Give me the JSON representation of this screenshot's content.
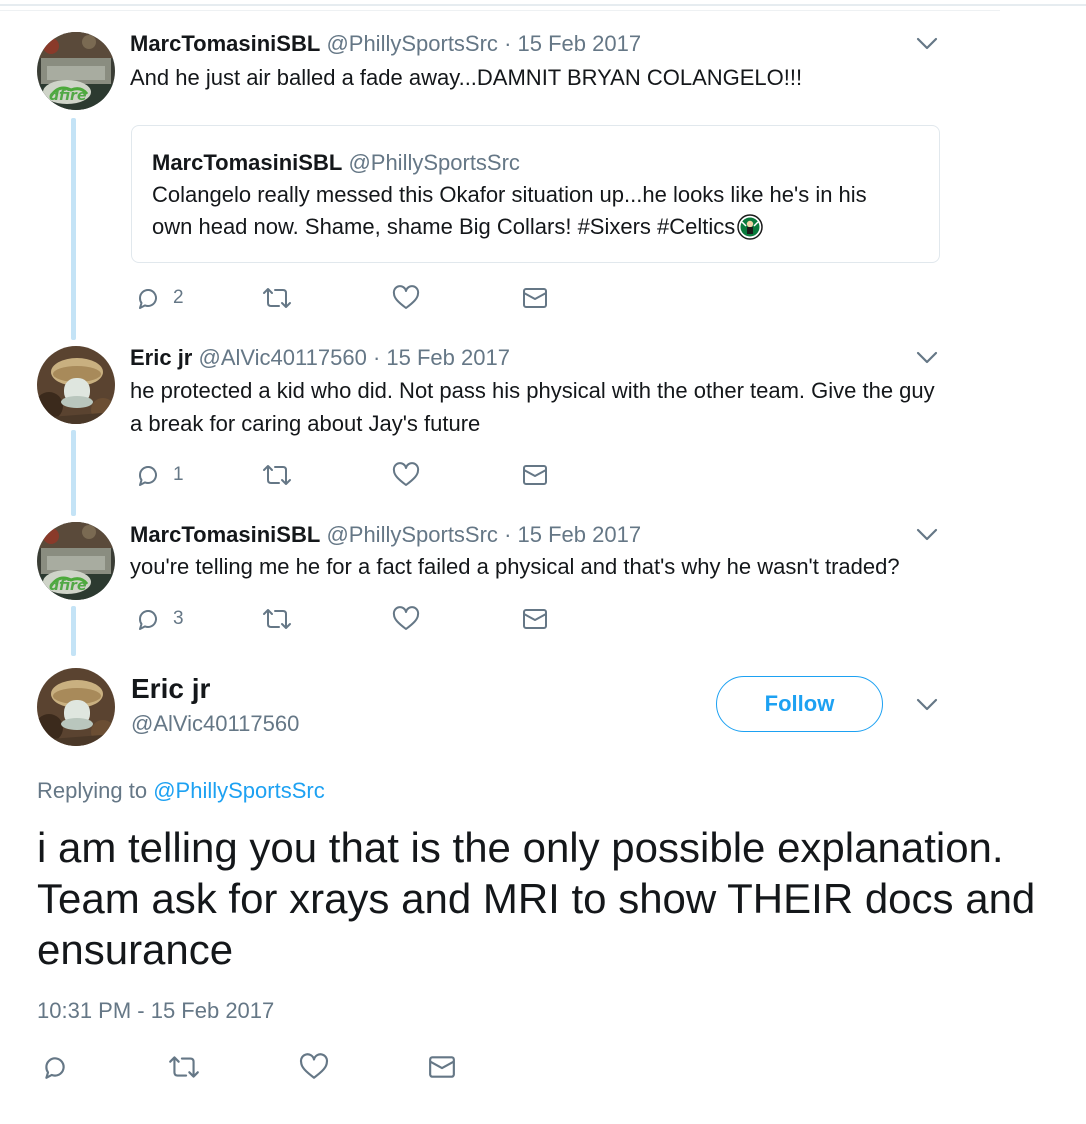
{
  "tweets": [
    {
      "name": "MarcTomasiniSBL",
      "handle": "@PhillySportsSrc",
      "date": "15 Feb 2017",
      "text": "And he just air balled a fade away...DAMNIT BRYAN COLANGELO!!!",
      "quote": {
        "name": "MarcTomasiniSBL",
        "handle": "@PhillySportsSrc",
        "text": "Colangelo really messed this Okafor situation up...he looks like he's in his own head now. Shame, shame Big Collars! #Sixers #Celtics"
      },
      "reply_count": "2"
    },
    {
      "name": "Eric jr",
      "handle": "@AlVic40117560",
      "date": "15 Feb 2017",
      "text": "he protected a kid who did. Not pass his physical with the other team. Give the guy a break for caring about  Jay's future",
      "reply_count": "1"
    },
    {
      "name": "MarcTomasiniSBL",
      "handle": "@PhillySportsSrc",
      "date": "15 Feb 2017",
      "text": "you're telling me he for a fact failed a physical and that's why he wasn't traded?",
      "reply_count": "3"
    }
  ],
  "separator": "·",
  "main": {
    "name": "Eric jr",
    "handle": "@AlVic40117560",
    "follow_label": "Follow",
    "replying_prefix": "Replying to",
    "replying_to": "@PhillySportsSrc",
    "text": "i am telling you that is the only possible explanation. Team ask for xrays and MRI to show THEIR docs and ensurance",
    "timestamp": "10:31 PM - 15 Feb 2017"
  },
  "icons": {
    "reply": "reply-icon",
    "retweet": "retweet-icon",
    "like": "heart-icon",
    "dm": "envelope-icon",
    "menu": "chevron-down-icon",
    "badge": "celtics-logo-icon"
  },
  "colors": {
    "accent": "#1da1f2",
    "muted": "#657786",
    "thread_line": "#c4e3f6",
    "border": "#e1e8ed"
  }
}
